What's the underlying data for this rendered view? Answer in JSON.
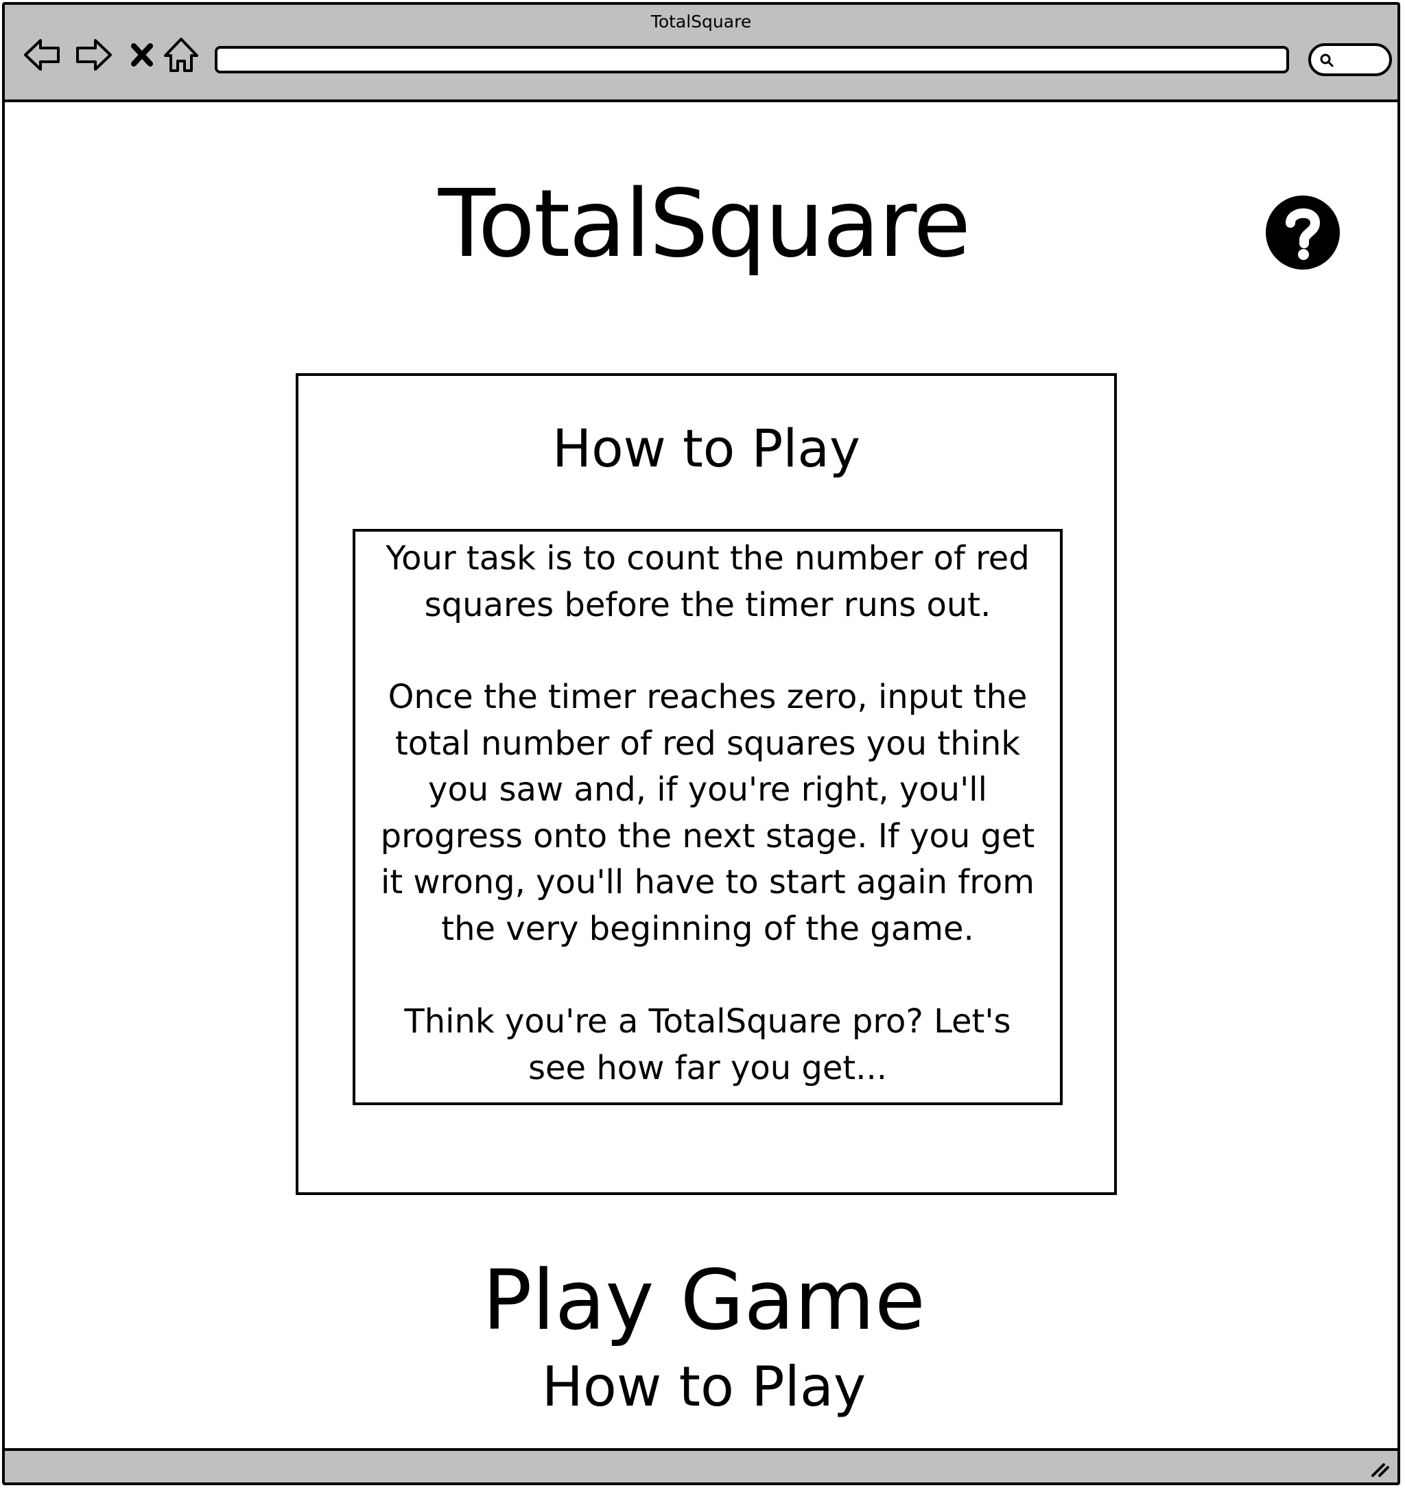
{
  "window": {
    "title": "TotalSquare",
    "url": "",
    "search_placeholder": ""
  },
  "toolbar": {
    "icons": [
      "back-arrow-icon",
      "forward-arrow-icon",
      "stop-icon",
      "home-icon",
      "search-icon"
    ]
  },
  "header": {
    "title": "TotalSquare",
    "help_icon": "question-mark-circle-icon"
  },
  "how_to_play": {
    "title": "How to Play",
    "paragraphs": [
      [
        "Your task is to count the number of red",
        "squares before the timer runs out."
      ],
      [
        "Once the timer reaches zero, input the",
        "total number of red squares you think",
        "you saw and, if you're right, you'll",
        "progress onto the next stage. If you get",
        "it wrong, you'll have to start again from",
        "the very beginning of the game."
      ],
      [
        "Think you're a TotalSquare pro? Let's",
        "see how far you get..."
      ]
    ]
  },
  "menu": {
    "play_label": "Play Game",
    "how_to_label": "How to Play"
  }
}
